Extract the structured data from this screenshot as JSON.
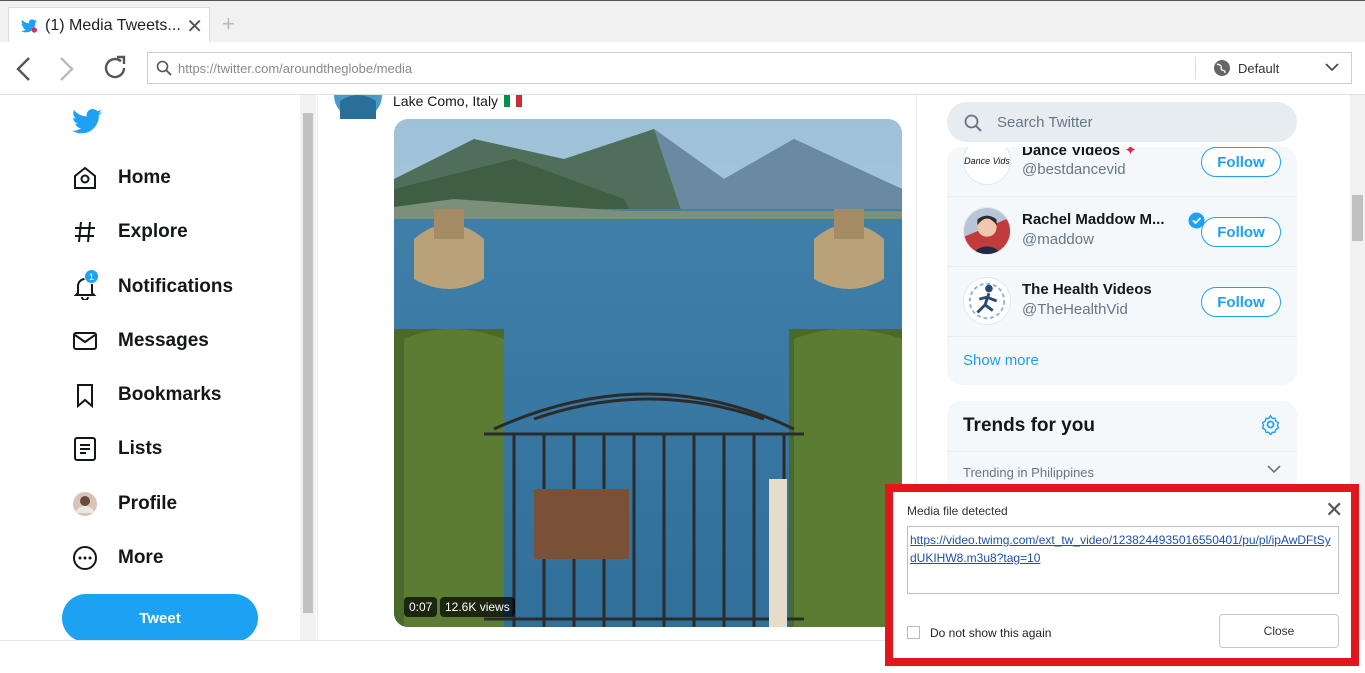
{
  "browser": {
    "tab_title": "(1) Media Tweets...",
    "url": "https://twitter.com/aroundtheglobe/media",
    "mode": "Default"
  },
  "nav": {
    "items": [
      {
        "label": "Home",
        "icon": "home-icon"
      },
      {
        "label": "Explore",
        "icon": "hashtag-icon"
      },
      {
        "label": "Notifications",
        "icon": "bell-icon"
      },
      {
        "label": "Messages",
        "icon": "envelope-icon"
      },
      {
        "label": "Bookmarks",
        "icon": "bookmark-icon"
      },
      {
        "label": "Lists",
        "icon": "list-icon"
      },
      {
        "label": "Profile",
        "icon": "avatar"
      },
      {
        "label": "More",
        "icon": "more-icon"
      }
    ],
    "notifications_badge": "1",
    "tweet_label": "Tweet"
  },
  "feed": {
    "location": "Lake Como, Italy",
    "video_duration": "0:07",
    "video_views": "12.6K views"
  },
  "sidebar": {
    "search_placeholder": "Search Twitter",
    "who_to_follow": [
      {
        "name": "Dance Videos",
        "handle": "@bestdancevid",
        "avatar_text": "Dance Vids",
        "follow_label": "Follow"
      },
      {
        "name": "Rachel Maddow M...",
        "handle": "@maddow",
        "verified": true,
        "follow_label": "Follow"
      },
      {
        "name": "The Health Videos",
        "handle": "@TheHealthVid",
        "follow_label": "Follow"
      }
    ],
    "show_more": "Show more",
    "trends_title": "Trends for you",
    "trend_context": "Trending in Philippines"
  },
  "popup": {
    "title": "Media file detected",
    "media_url": "https://video.twimg.com/ext_tw_video/1238244935016550401/pu/pl/ipAwDFtSydUKIHW8.m3u8?tag=10",
    "checkbox_label": "Do not show this again",
    "close_label": "Close"
  },
  "colors": {
    "twitter_blue": "#1da1f2",
    "popup_highlight": "#e3161e"
  }
}
